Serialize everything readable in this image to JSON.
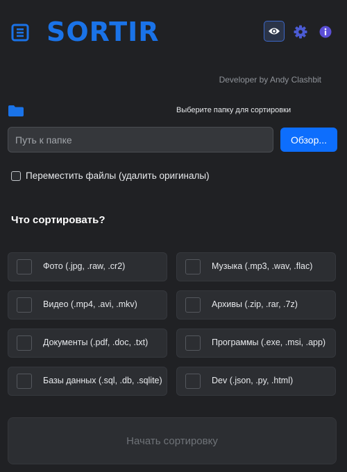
{
  "header": {
    "title": "SORTIR",
    "logo_icon": "list-document-icon",
    "eye_icon": "eye-icon",
    "gear_icon": "gear-icon",
    "info_icon": "info-icon",
    "accent_color": "#1a73e8"
  },
  "developer_credit": "Developer by Andy Clashbit",
  "folder": {
    "icon": "folder-icon",
    "prompt": "Выберите папку для сортировки",
    "input_placeholder": "Путь к папке",
    "input_value": "",
    "browse_label": "Обзор..."
  },
  "move_files": {
    "label": "Переместить файлы (удалить оригиналы)",
    "checked": false
  },
  "section_title": "Что сортировать?",
  "options": [
    {
      "label": "Фото (.jpg, .raw, .cr2)",
      "checked": false
    },
    {
      "label": "Музыка (.mp3, .wav, .flac)",
      "checked": false
    },
    {
      "label": "Видео (.mp4, .avi, .mkv)",
      "checked": false
    },
    {
      "label": "Архивы (.zip, .rar, .7z)",
      "checked": false
    },
    {
      "label": "Документы (.pdf, .doc, .txt)",
      "checked": false
    },
    {
      "label": "Программы (.exe, .msi, .app)",
      "checked": false
    },
    {
      "label": "Базы данных (.sql, .db, .sqlite)",
      "checked": false
    },
    {
      "label": "Dev (.json, .py, .html)",
      "checked": false
    }
  ],
  "start_button": {
    "label": "Начать сортировку",
    "enabled": false
  }
}
